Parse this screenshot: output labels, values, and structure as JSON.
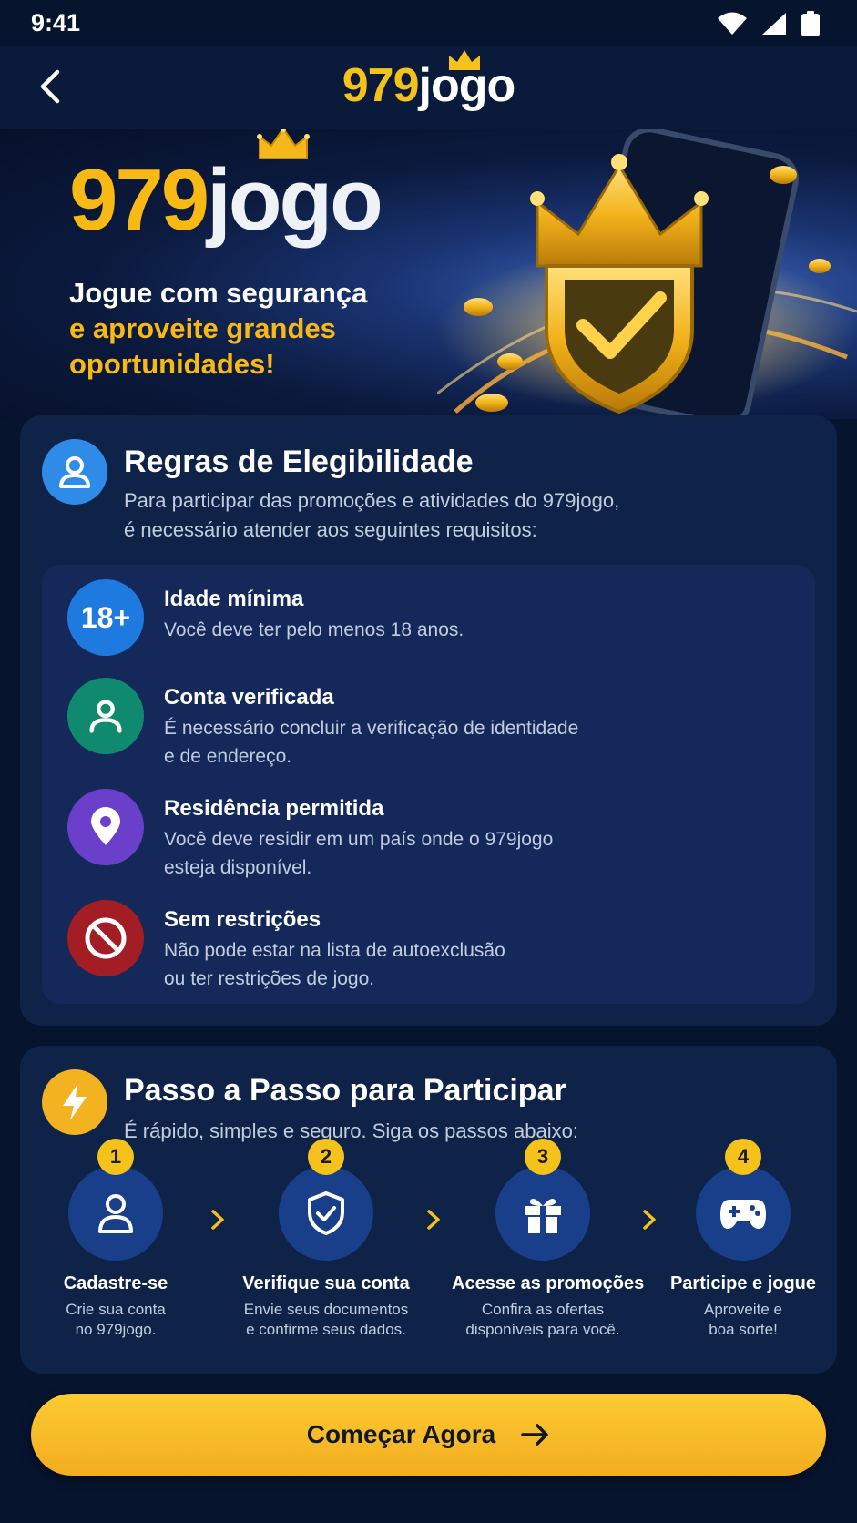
{
  "status_bar": {
    "time": "9:41"
  },
  "header": {
    "logo_num": "979",
    "logo_word": "jogo"
  },
  "hero": {
    "logo_num": "979",
    "logo_word": "jogo",
    "line1": "Jogue com segurança",
    "line2": "e aproveite grandes",
    "line3": "oportunidades!"
  },
  "eligibility": {
    "title": "Regras de Elegibilidade",
    "desc_line1": "Para participar das promoções e atividades do 979jogo,",
    "desc_line2": "é necessário atender aos seguintes requisitos:",
    "rules": [
      {
        "badge": "18+",
        "title": "Idade mínima",
        "desc_line1": "Você deve ter pelo menos 18 anos.",
        "desc_line2": "",
        "color": "#1f7ae0"
      },
      {
        "title": "Conta verificada",
        "desc_line1": "É necessário concluir a verificação de identidade",
        "desc_line2": "e de endereço.",
        "color": "#0f8a6f"
      },
      {
        "title": "Residência permitida",
        "desc_line1": "Você deve residir em um país onde o 979jogo",
        "desc_line2": "esteja disponível.",
        "color": "#6a3fc9"
      },
      {
        "title": "Sem restrições",
        "desc_line1": "Não pode estar na lista de autoexclusão",
        "desc_line2": "ou ter restrições de jogo.",
        "color": "#a31d24"
      }
    ]
  },
  "steps_section": {
    "title": "Passo a Passo para Participar",
    "desc": "É rápido, simples e seguro. Siga os passos abaixo:",
    "steps": [
      {
        "number": "1",
        "title": "Cadastre-se",
        "desc_line1": "Crie sua conta",
        "desc_line2": "no 979jogo."
      },
      {
        "number": "2",
        "title": "Verifique sua conta",
        "desc_line1": "Envie seus documentos",
        "desc_line2": "e confirme seus dados."
      },
      {
        "number": "3",
        "title": "Acesse as promoções",
        "desc_line1": "Confira as ofertas",
        "desc_line2": "disponíveis para você."
      },
      {
        "number": "4",
        "title": "Participe e jogue",
        "desc_line1": "Aproveite e",
        "desc_line2": "boa sorte!"
      }
    ]
  },
  "cta": {
    "label": "Começar Agora"
  },
  "colors": {
    "accent": "#f5c21b",
    "background": "#07142e",
    "card": "#0f2349"
  }
}
